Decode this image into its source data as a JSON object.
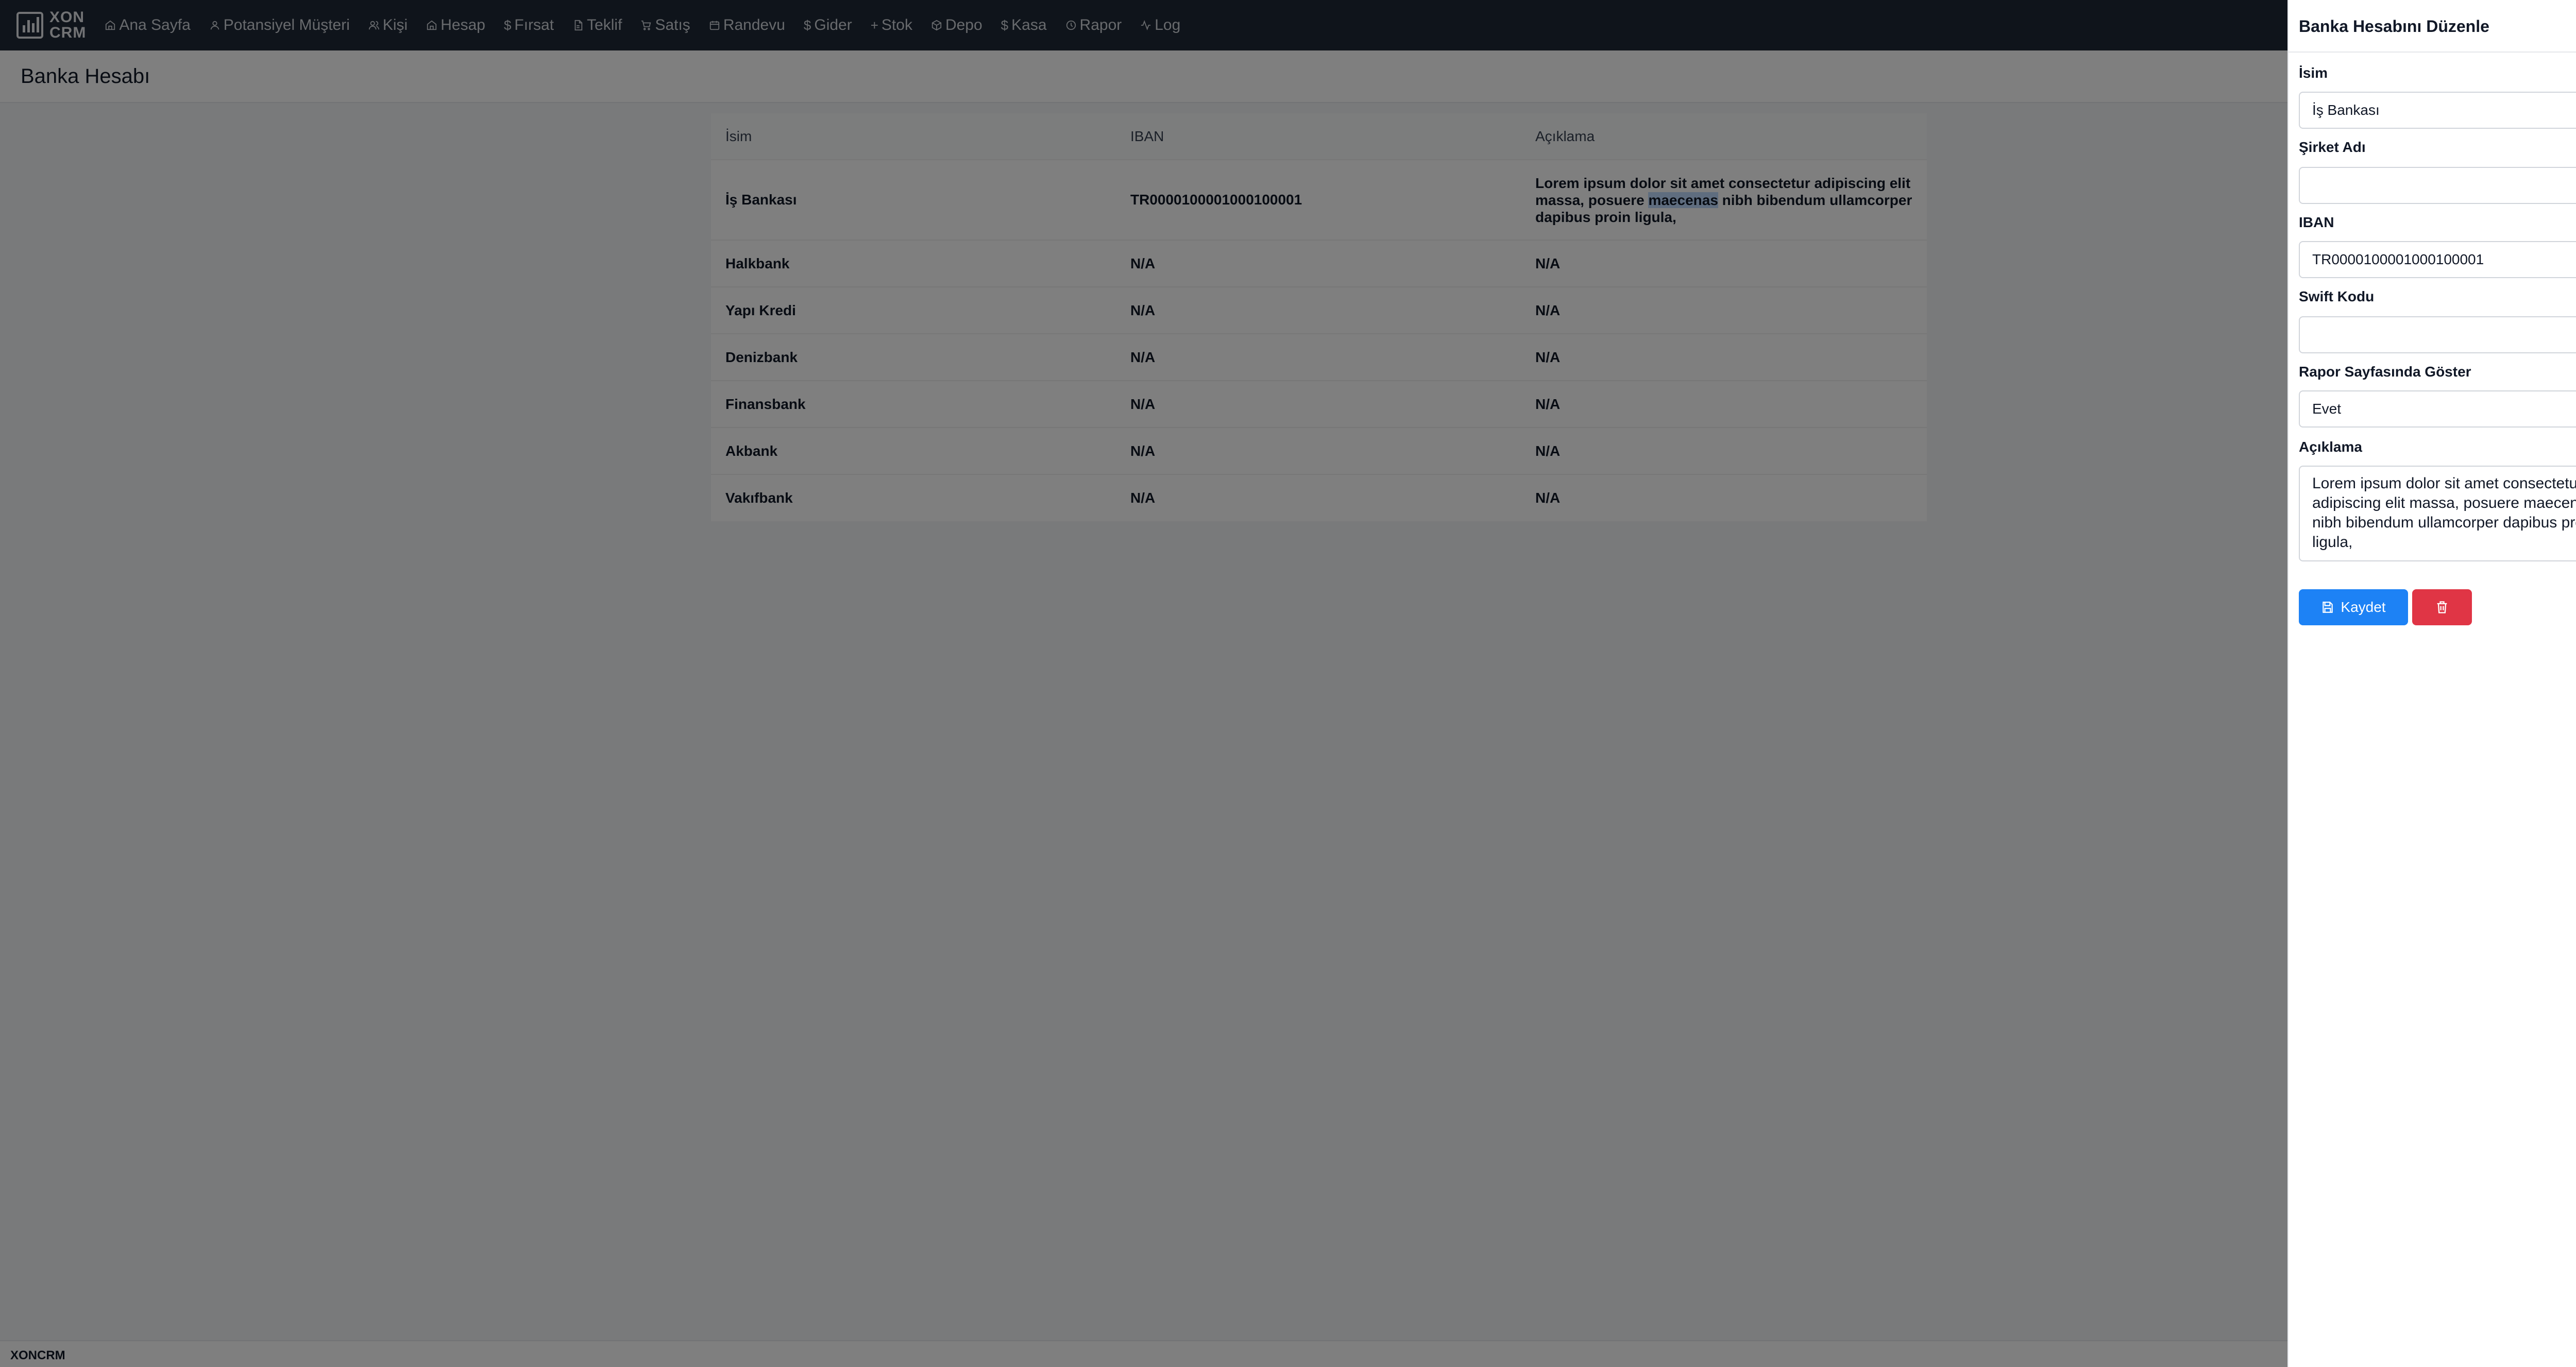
{
  "app": {
    "logo_text_line1": "XON",
    "logo_text_line2": "CRM",
    "footer_text": "XONCRM"
  },
  "nav": {
    "items": [
      {
        "label": "Ana Sayfa",
        "icon": "home-icon"
      },
      {
        "label": "Potansiyel Müşteri",
        "icon": "user-icon"
      },
      {
        "label": "Kişi",
        "icon": "users-icon"
      },
      {
        "label": "Hesap",
        "icon": "home-icon"
      },
      {
        "label": "Fırsat",
        "icon": "dollar-icon"
      },
      {
        "label": "Teklif",
        "icon": "file-icon"
      },
      {
        "label": "Satış",
        "icon": "cart-icon"
      },
      {
        "label": "Randevu",
        "icon": "calendar-icon"
      },
      {
        "label": "Gider",
        "icon": "dollar-icon"
      },
      {
        "label": "Stok",
        "icon": "plus-icon"
      },
      {
        "label": "Depo",
        "icon": "package-icon"
      },
      {
        "label": "Kasa",
        "icon": "dollar-icon"
      },
      {
        "label": "Rapor",
        "icon": "clock-icon"
      },
      {
        "label": "Log",
        "icon": "activity-icon"
      }
    ]
  },
  "page": {
    "title": "Banka Hesabı"
  },
  "table": {
    "headers": [
      "İsim",
      "IBAN",
      "Açıklama"
    ],
    "rows": [
      {
        "name": "İş Bankası",
        "iban": "TR0000100001000100001",
        "desc_before": "Lorem ipsum dolor sit amet consectetur adipiscing elit massa, posuere ",
        "desc_selected": "maecenas",
        "desc_after": " nibh bibendum ullamcorper dapibus proin ligula,"
      },
      {
        "name": "Halkbank",
        "iban": "N/A",
        "desc": "N/A"
      },
      {
        "name": "Yapı Kredi",
        "iban": "N/A",
        "desc": "N/A"
      },
      {
        "name": "Denizbank",
        "iban": "N/A",
        "desc": "N/A"
      },
      {
        "name": "Finansbank",
        "iban": "N/A",
        "desc": "N/A"
      },
      {
        "name": "Akbank",
        "iban": "N/A",
        "desc": "N/A"
      },
      {
        "name": "Vakıfbank",
        "iban": "N/A",
        "desc": "N/A"
      }
    ]
  },
  "drawer": {
    "title": "Banka Hesabını Düzenle",
    "fields": {
      "name": {
        "label": "İsim",
        "value": "İş Bankası"
      },
      "company": {
        "label": "Şirket Adı",
        "value": ""
      },
      "iban": {
        "label": "IBAN",
        "value": "TR0000100001000100001"
      },
      "swift": {
        "label": "Swift Kodu",
        "value": ""
      },
      "show_in_report": {
        "label": "Rapor Sayfasında Göster",
        "value": "Evet"
      },
      "description": {
        "label": "Açıklama",
        "value": "Lorem ipsum dolor sit amet consectetur adipiscing elit massa, posuere maecenas nibh bibendum ullamcorper dapibus proin ligula,"
      }
    },
    "save_label": "Kaydet"
  },
  "colors": {
    "nav_bg": "#1f2937",
    "primary": "#1d82f5",
    "danger": "#e03545",
    "overlay": "rgba(0,0,0,0.5)"
  }
}
